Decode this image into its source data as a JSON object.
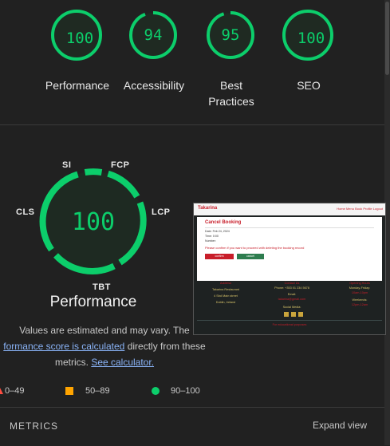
{
  "categories": [
    {
      "name": "Performance",
      "score": "100",
      "label_lines": [
        "Performance"
      ]
    },
    {
      "name": "Accessibility",
      "score": "94",
      "label_lines": [
        "Accessibility"
      ]
    },
    {
      "name": "Best Practices",
      "score": "95",
      "label_lines": [
        "Best",
        "Practices"
      ]
    },
    {
      "name": "SEO",
      "score": "100",
      "label_lines": [
        "SEO"
      ]
    }
  ],
  "main": {
    "score": "100",
    "title": "Performance",
    "metric_tags": [
      "SI",
      "FCP",
      "LCP",
      "TBT",
      "CLS"
    ],
    "description": {
      "text1": "Values are estimated and may vary. The",
      "link1": "formance score is calculated",
      "text2": "directly from these",
      "text3": "metrics.",
      "link2": "See calculator."
    }
  },
  "legend": {
    "fail": "0–49",
    "average": "50–89",
    "pass": "90–100"
  },
  "metrics": {
    "heading": "METRICS",
    "expand": "Expand view"
  },
  "thumbnail": {
    "logo": "Takarina",
    "nav_links": "Home  Menu  Book  Profile  Logout",
    "heading": "Cancel Booking",
    "fields": [
      "Date: Feb 24, 2024",
      "Time: 0:00",
      "Number:"
    ],
    "message": "Please confirm if you want to proceed with deleting the booking record",
    "btn_confirm": "confirm",
    "btn_cancel": "cancel",
    "footer": {
      "col1_title": "Address",
      "col1_lines": [
        "Takarina Restaurant",
        "4 Sbd Main street",
        "Dublin, Ireland"
      ],
      "col2_title": "Contact Us",
      "col2_lines": [
        "Phone: +353 01 234 5678",
        "Email:",
        "takarina@gmail.com",
        "Social Media:"
      ],
      "col3_title": "Opening Hours",
      "col3_lines": [
        "Monday-Friday:",
        "10am-10pm",
        "Weekends:",
        "12pm-12am"
      ],
      "bottom": "For educational purposes"
    }
  },
  "colors": {
    "pass": "#0cce6b",
    "average": "#ffa400",
    "fail": "#ff4e42",
    "link": "#8ab4f8"
  }
}
